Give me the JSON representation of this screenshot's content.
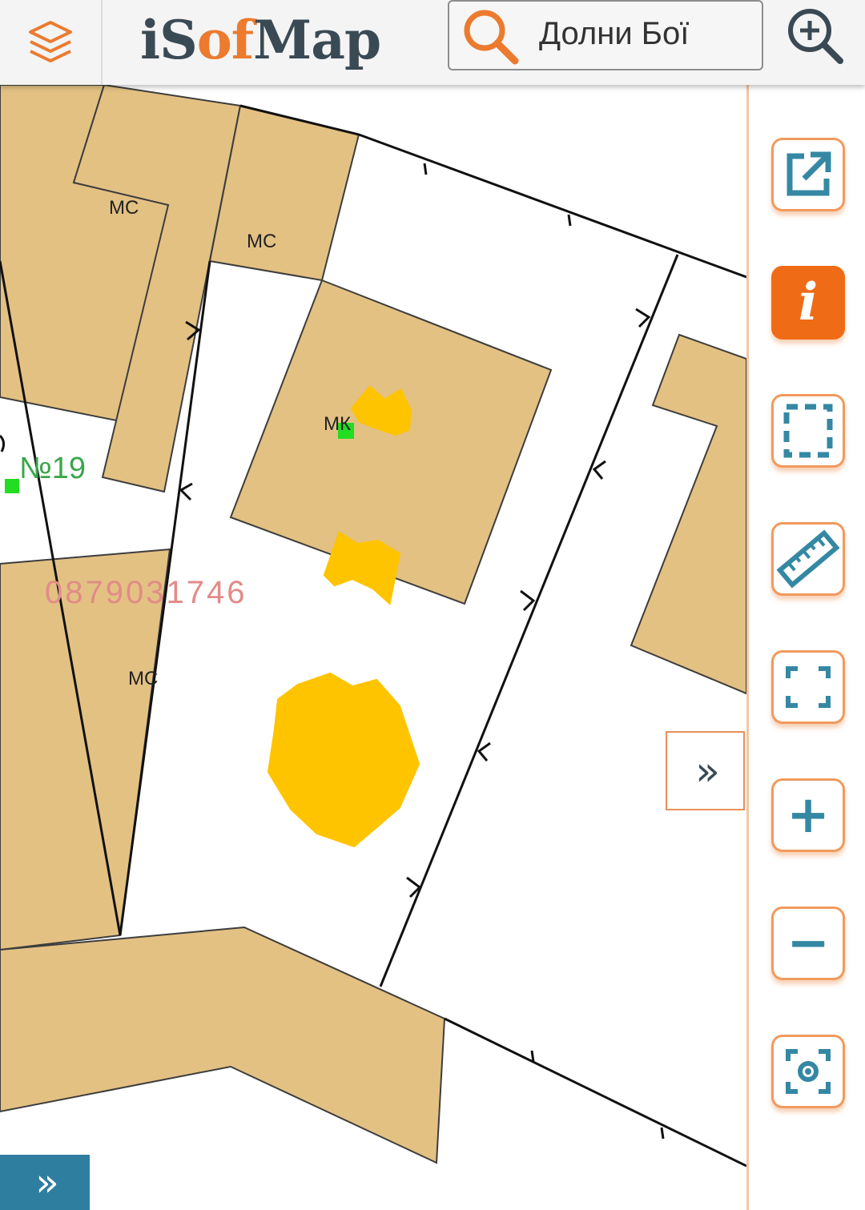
{
  "header": {
    "logo_part1": "iS",
    "logo_part2": "of",
    "logo_part3": "Map",
    "search_value": "Долни Бої"
  },
  "map": {
    "labels": [
      "МС",
      "МС",
      "МС",
      "МК"
    ],
    "parcel_number": "№19",
    "overlay_text": "0879031746",
    "fill_color": "#e3c183",
    "marker_color": "#22dd22",
    "scribble_color": "#ffc400"
  },
  "toolbar": {
    "items": [
      {
        "name": "open-external-icon"
      },
      {
        "name": "info-icon",
        "label": "i",
        "active": true
      },
      {
        "name": "select-area-icon"
      },
      {
        "name": "ruler-icon"
      },
      {
        "name": "fullscreen-icon"
      },
      {
        "name": "zoom-in-icon",
        "label": "+"
      },
      {
        "name": "zoom-out-icon",
        "label": "−"
      },
      {
        "name": "locate-icon"
      }
    ]
  },
  "panel": {
    "expand_label": "»"
  },
  "colors": {
    "accent": "#ec7a2f",
    "icon": "#3488a4",
    "dark": "#3a4a55"
  }
}
